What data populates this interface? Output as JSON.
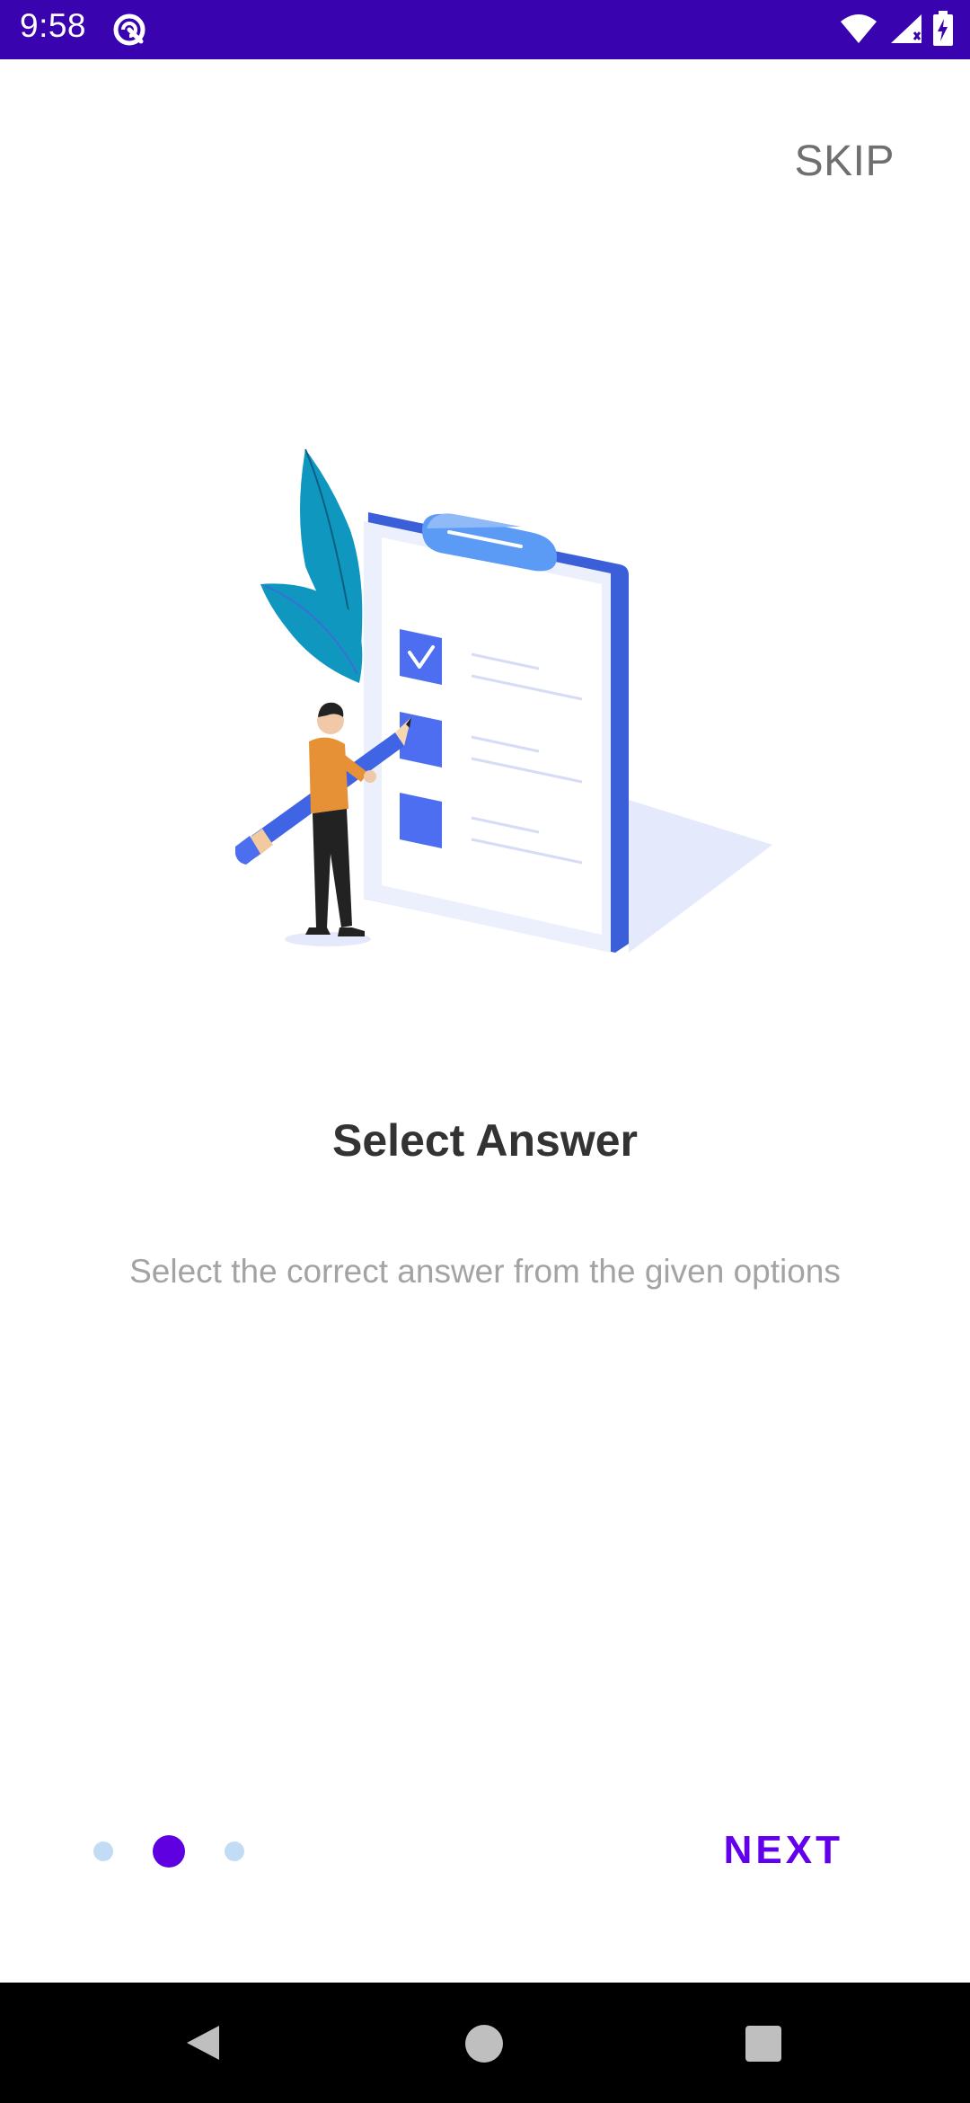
{
  "status_bar": {
    "time": "9:58",
    "background": "#3a03b0",
    "icons": [
      "app-notification-icon",
      "wifi-icon",
      "signal-icon",
      "battery-charging-icon"
    ]
  },
  "onboarding": {
    "skip_label": "SKIP",
    "title": "Select Answer",
    "description": "Select the correct answer from the given options",
    "illustration": "person-with-pencil-and-checklist-clipboard",
    "page_indicator": {
      "count": 3,
      "active_index": 1
    },
    "next_label": "NEXT"
  },
  "colors": {
    "accent": "#6200ee",
    "active_dot": "#5e00e0",
    "inactive_dot": "#c3dcf6",
    "title_text": "#333333",
    "description_text": "#a3a3a3",
    "skip_text": "#6f6f6f"
  },
  "nav_bar": {
    "icons": [
      "back-icon",
      "home-icon",
      "recents-icon"
    ]
  }
}
